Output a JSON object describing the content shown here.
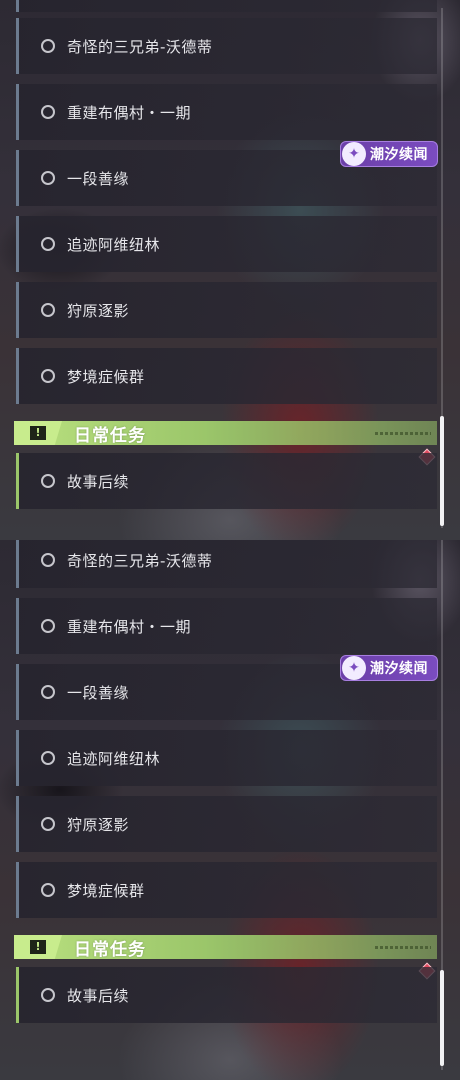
{
  "quests": [
    "奇怪的三兄弟-沃德蒂",
    "重建布偶村・一期",
    "一段善缘",
    "追迹阿维纽林",
    "狩原逐影",
    "梦境症候群"
  ],
  "badge": {
    "text": "潮汐续闻",
    "icon": "sparkle-icon"
  },
  "daily": {
    "title": "日常任务",
    "icon": "exclamation-icon",
    "quest": "故事后续"
  },
  "colors": {
    "accent_green": "#9bc66a",
    "badge_purple": "#7b4cc0",
    "alert_red": "#e04a5e"
  }
}
